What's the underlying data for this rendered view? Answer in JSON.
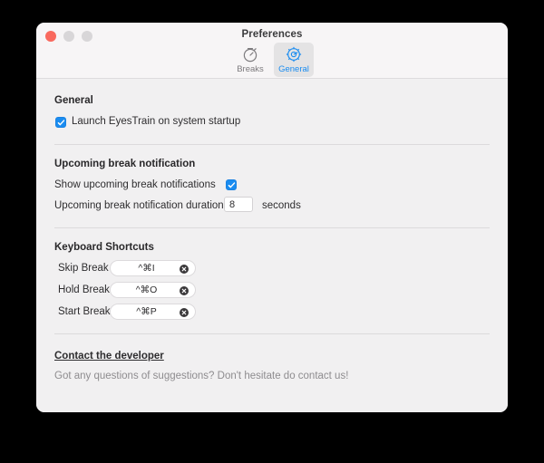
{
  "window": {
    "title": "Preferences",
    "traffic_lights": [
      "close",
      "minimize",
      "zoom"
    ]
  },
  "toolbar": {
    "tabs": [
      {
        "label": "Breaks",
        "icon": "timer-icon",
        "selected": false
      },
      {
        "label": "General",
        "icon": "gear-icon",
        "selected": true
      }
    ],
    "accent_color": "#1a8cf0",
    "selected_tab_bg": "#e4e3e4"
  },
  "general_section": {
    "heading": "General",
    "launch_startup": {
      "label": "Launch EyesTrain on system startup",
      "checked": true
    }
  },
  "notification_section": {
    "heading": "Upcoming break notification",
    "show_notifications": {
      "label": "Show upcoming break notifications",
      "checked": true
    },
    "duration": {
      "label": "Upcoming break notification duration",
      "value": "8",
      "unit": "seconds"
    }
  },
  "shortcuts_section": {
    "heading": "Keyboard Shortcuts",
    "items": [
      {
        "label": "Skip Break",
        "value": "^⌘I"
      },
      {
        "label": "Hold Break",
        "value": "^⌘O"
      },
      {
        "label": "Start Break",
        "value": "^⌘P"
      }
    ]
  },
  "footer": {
    "link": "Contact the developer",
    "subtext": "Got any questions of suggestions? Don't hesitate do contact us!"
  }
}
